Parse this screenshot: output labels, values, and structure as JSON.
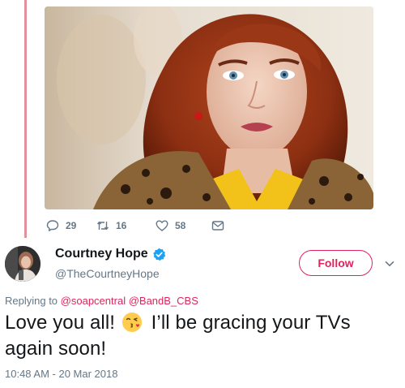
{
  "tweet_actions": {
    "reply_count": "29",
    "retweet_count": "16",
    "like_count": "58"
  },
  "tweet": {
    "author": {
      "display_name": "Courtney Hope",
      "handle": "@TheCourtneyHope"
    },
    "follow_label": "Follow",
    "replying_to_label": "Replying to",
    "replying_to": [
      "@soapcentral",
      "@BandB_CBS"
    ],
    "text_before_emoji": "Love you all!",
    "emoji": "face-throwing-kiss",
    "text_after_emoji": "I’ll be gracing your TVs again soon!",
    "timestamp": "10:48 AM - 20 Mar 2018"
  },
  "colors": {
    "accent": "#e0245e",
    "thread_line": "#e2909c",
    "secondary_text": "#657786",
    "verified": "#1da1f2"
  }
}
